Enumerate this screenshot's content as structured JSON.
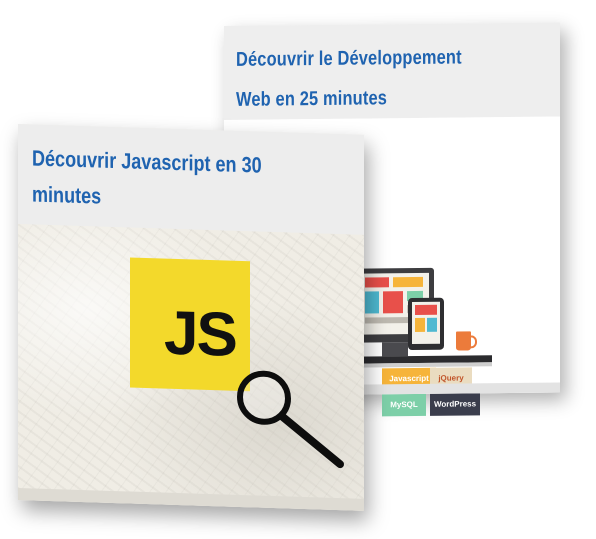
{
  "cards": [
    {
      "title": "Découvrir le Développement Web en 25 minutes",
      "illustration": "web-development-devices",
      "tags": [
        "Javascript",
        "jQuery",
        "MySQL",
        "WordPress"
      ]
    },
    {
      "title": "Découvrir Javascript en 30 minutes",
      "illustration": "javascript-logo-with-magnifier",
      "logo_text": "JS"
    }
  ],
  "colors": {
    "title_blue": "#1f63b0",
    "js_yellow": "#f3d92b",
    "tag_javascript": "#f6b43a",
    "tag_jquery": "#eadcc0",
    "tag_mysql": "#7dcfa8",
    "tag_wordpress": "#3a3d4c"
  }
}
